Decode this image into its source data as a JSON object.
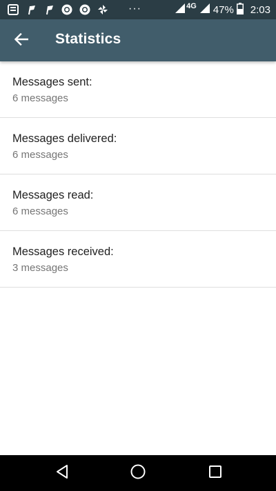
{
  "status_bar": {
    "dots": "···",
    "network": "4G",
    "battery": "47%",
    "time": "2:03",
    "icons": [
      "notes-icon",
      "flag-icon",
      "flag-icon",
      "ring-icon",
      "ring-icon",
      "pinwheel-icon",
      "signal-icon",
      "signal-icon",
      "battery-icon"
    ]
  },
  "app_bar": {
    "title": "Statistics",
    "back_icon": "arrow-back-icon",
    "background": "#415d6b"
  },
  "stats": [
    {
      "label": "Messages sent:",
      "value": "6 messages"
    },
    {
      "label": "Messages delivered:",
      "value": "6 messages"
    },
    {
      "label": "Messages read:",
      "value": "6 messages"
    },
    {
      "label": "Messages received:",
      "value": "3 messages"
    }
  ],
  "nav_bar": {
    "buttons": [
      "back-triangle-icon",
      "home-circle-icon",
      "recents-square-icon"
    ]
  }
}
